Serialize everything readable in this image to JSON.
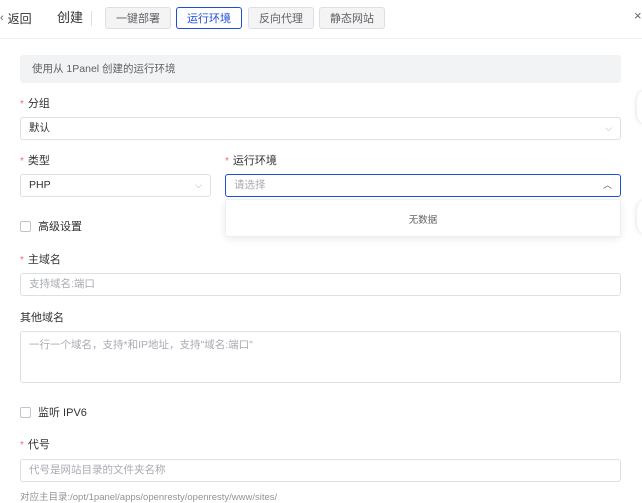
{
  "header": {
    "back_label": "返回",
    "title": "创建",
    "tabs": [
      {
        "label": "一键部署"
      },
      {
        "label": "运行环境"
      },
      {
        "label": "反向代理"
      },
      {
        "label": "静态网站"
      }
    ],
    "close_icon": "×"
  },
  "notice": "使用从 1Panel 创建的运行环境",
  "form": {
    "group": {
      "label": "分组",
      "value": "默认"
    },
    "type": {
      "label": "类型",
      "value": "PHP"
    },
    "runtime": {
      "label": "运行环境",
      "placeholder": "请选择",
      "dropdown_empty": "无数据"
    },
    "advanced": {
      "label": "高级设置"
    },
    "primary_domain": {
      "label": "主域名",
      "placeholder": "支持域名:端口"
    },
    "other_domains": {
      "label": "其他域名",
      "placeholder": "一行一个域名，支持*和IP地址，支持\"域名:端口\""
    },
    "listen_ipv6": {
      "label": "监听 IPV6"
    },
    "code": {
      "label": "代号",
      "placeholder": "代号是网站目录的文件夹名称"
    },
    "root_hint": "对应主目录:/opt/1panel/apps/openresty/openresty/www/sites/"
  },
  "colors": {
    "accent": "#1d4ed8",
    "required": "#f56c6c"
  }
}
